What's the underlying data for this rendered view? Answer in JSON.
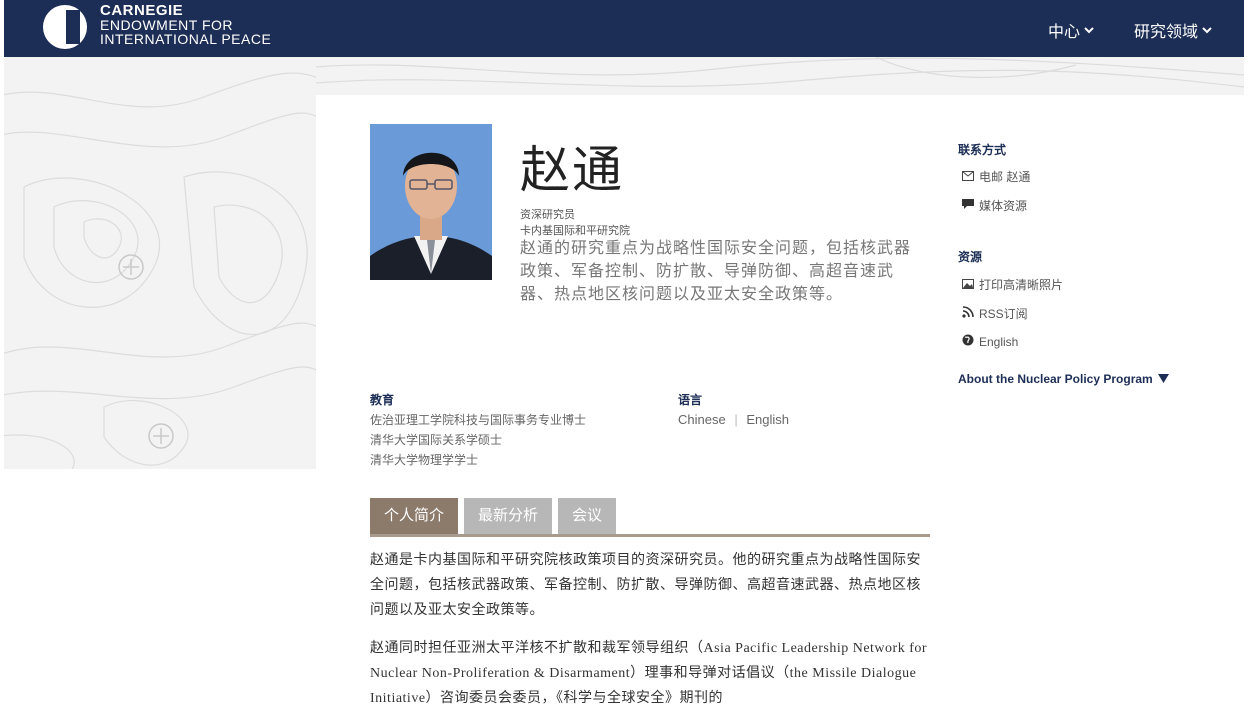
{
  "brand": {
    "line1": "CARNEGIE",
    "line2": "ENDOWMENT FOR",
    "line3": "INTERNATIONAL PEACE",
    "color": "#1c2e55"
  },
  "nav": [
    {
      "label": "中心",
      "icon": "chevron-down-icon"
    },
    {
      "label": "研究领域",
      "icon": "chevron-down-icon"
    }
  ],
  "profile": {
    "name": "赵通",
    "role1": "资深研究员",
    "role2": "卡内基国际和平研究院",
    "summary": "赵通的研究重点为战略性国际安全问题，包括核武器政策、军备控制、防扩散、导弹防御、高超音速武器、热点地区核问题以及亚太安全政策等。"
  },
  "education": {
    "heading": "教育",
    "items": [
      "佐治亚理工学院科技与国际事务专业博士",
      "清华大学国际关系学硕士",
      "清华大学物理学学士"
    ]
  },
  "languages": {
    "heading": "语言",
    "items": [
      "Chinese",
      "English"
    ],
    "separator": "|"
  },
  "sidebar": {
    "contact_heading": "联系方式",
    "contact_items": [
      {
        "label": "电邮 赵通",
        "icon": "mail-icon"
      },
      {
        "label": "媒体资源",
        "icon": "comment-icon"
      }
    ],
    "resources_heading": "资源",
    "resource_items": [
      {
        "label": "打印高清晰照片",
        "icon": "image-icon"
      },
      {
        "label": "RSS订阅",
        "icon": "rss-icon"
      },
      {
        "label": "English",
        "icon": "globe-icon"
      }
    ],
    "program_link": "About the Nuclear Policy Program",
    "program_link_icon": "triangle-down-icon"
  },
  "tabs": [
    {
      "label": "个人简介",
      "active": true
    },
    {
      "label": "最新分析",
      "active": false
    },
    {
      "label": "会议",
      "active": false
    }
  ],
  "bio": {
    "p1": "赵通是卡内基国际和平研究院核政策项目的资深研究员。他的研究重点为战略性国际安全问题，包括核武器政策、军备控制、防扩散、导弹防御、高超音速武器、热点地区核问题以及亚太安全政策等。",
    "p2": "赵通同时担任亚洲太平洋核不扩散和裁军领导组织（Asia Pacific Leadership Network for Nuclear Non-Proliferation & Disarmament）理事和导弹对话倡议（the Missile Dialogue Initiative）咨询委员会委员，《科学与全球安全》期刊的"
  }
}
